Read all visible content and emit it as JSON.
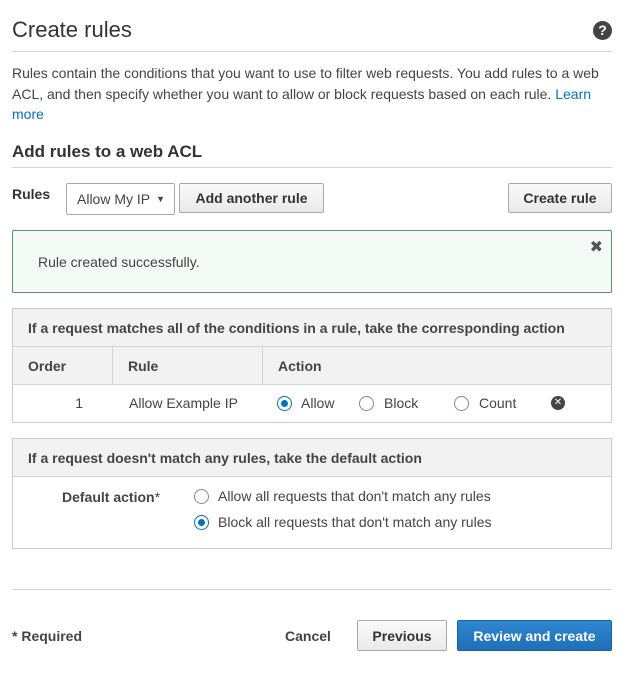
{
  "page": {
    "title": "Create rules",
    "help_icon": "help-icon"
  },
  "description": {
    "text": "Rules contain the conditions that you want to use to filter web requests. You add rules to a web ACL, and then specify whether you want to allow or block requests based on each rule. ",
    "link": "Learn more"
  },
  "section": {
    "title": "Add rules to a web ACL"
  },
  "rules_bar": {
    "label": "Rules",
    "select_value": "Allow My IP",
    "add_another_label": "Add another rule",
    "create_rule_label": "Create rule"
  },
  "alert": {
    "message": "Rule created successfully.",
    "close_icon": "close-icon"
  },
  "rules_table": {
    "header": "If a request matches all of the conditions in a rule, take the corresponding action",
    "columns": [
      "Order",
      "Rule",
      "Action"
    ],
    "rows": [
      {
        "order": "1",
        "rule": "Allow Example IP",
        "actions": [
          "Allow",
          "Block",
          "Count"
        ],
        "selected": "Allow"
      }
    ]
  },
  "default_action": {
    "header": "If a request doesn't match any rules, take the default action",
    "label": "Default action",
    "required_mark": "*",
    "options": [
      "Allow all requests that don't match any rules",
      "Block all requests that don't match any rules"
    ],
    "selected": "Block all requests that don't match any rules"
  },
  "footer": {
    "required_note": "* Required",
    "cancel_label": "Cancel",
    "previous_label": "Previous",
    "review_label": "Review and create"
  },
  "colors": {
    "primary": "#1f6fb8",
    "link": "#0073bb",
    "success_border": "#5f8f6c"
  }
}
